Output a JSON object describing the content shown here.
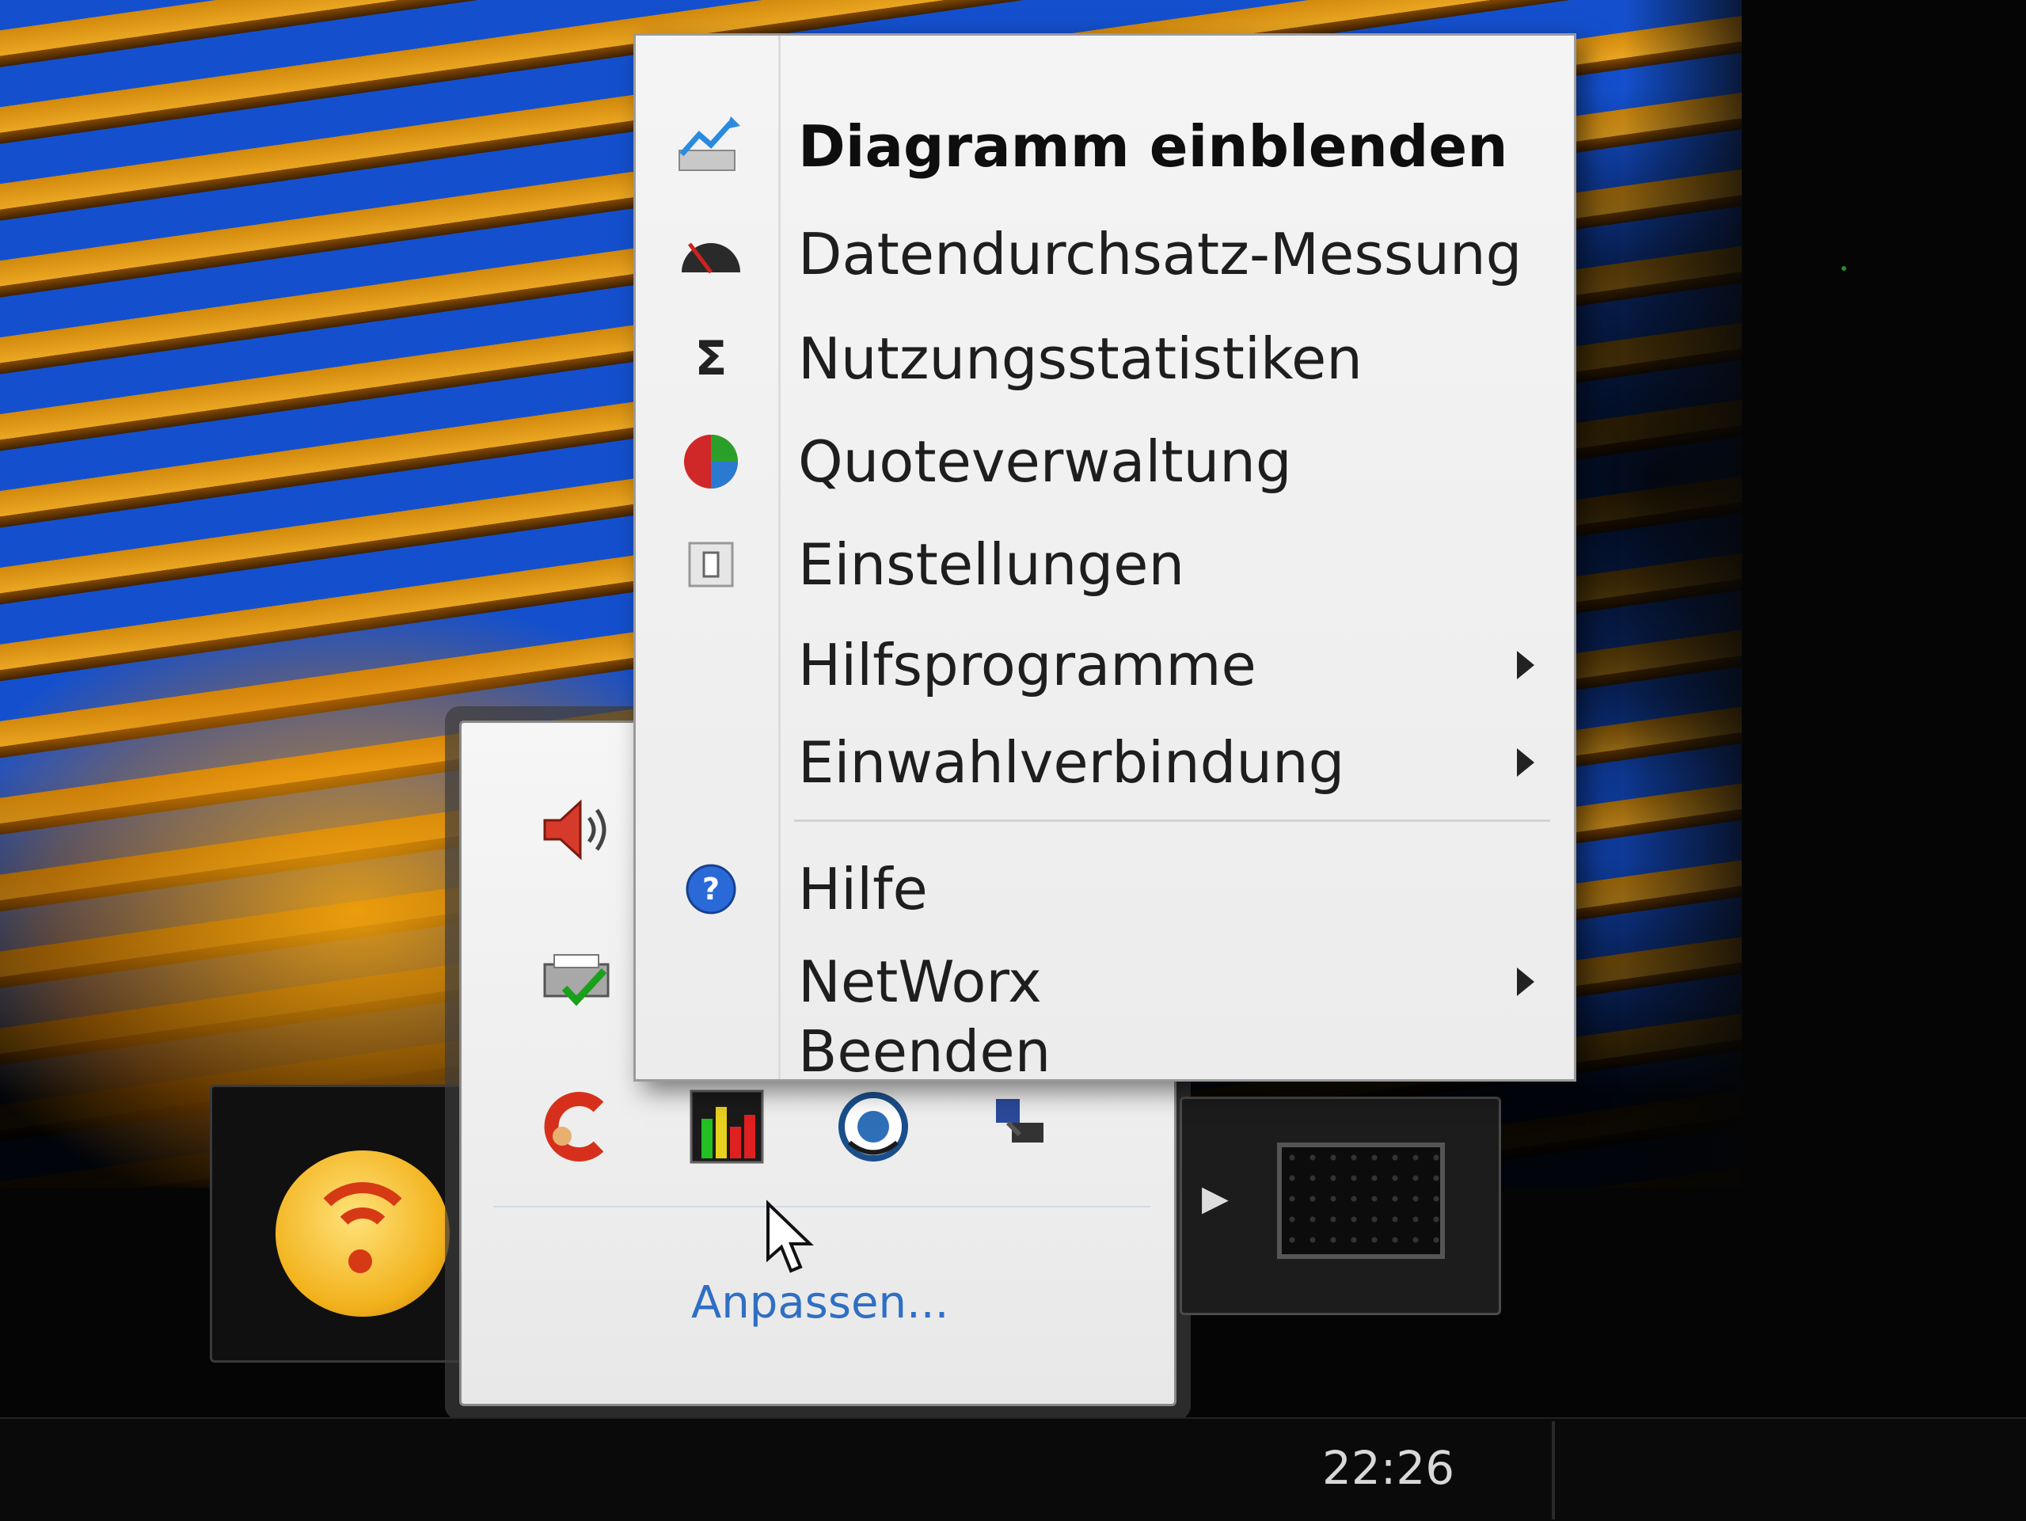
{
  "context_menu": {
    "items": [
      {
        "label": "Diagramm einblenden",
        "icon": "chart-icon",
        "bold": true
      },
      {
        "label": "Datendurchsatz-Messung",
        "icon": "speedometer-icon"
      },
      {
        "label": "Nutzungsstatistiken",
        "icon": "sigma-icon"
      },
      {
        "label": "Quoteverwaltung",
        "icon": "pie-chart-icon"
      },
      {
        "label": "Einstellungen",
        "icon": "settings-icon"
      },
      {
        "label": "Hilfsprogramme",
        "submenu": true
      },
      {
        "label": "Einwahlverbindung",
        "submenu": true
      },
      {
        "label": "Hilfe",
        "icon": "help-icon"
      },
      {
        "label": "NetWorx",
        "submenu": true
      },
      {
        "label": "Beenden"
      }
    ]
  },
  "tray_flyout": {
    "icons": [
      "speaker-icon",
      "printer-check-icon",
      "ccleaner-icon",
      "networx-bars-icon",
      "network-globe-icon",
      "network-connection-icon"
    ],
    "customize_label": "Anpassen..."
  },
  "taskbar": {
    "clock": "22:26"
  },
  "colors": {
    "link": "#2f6fc4",
    "menu_bg": "#f0f0f0",
    "wifi_yellow": "#f2b21c",
    "wifi_red": "#d63a14"
  }
}
